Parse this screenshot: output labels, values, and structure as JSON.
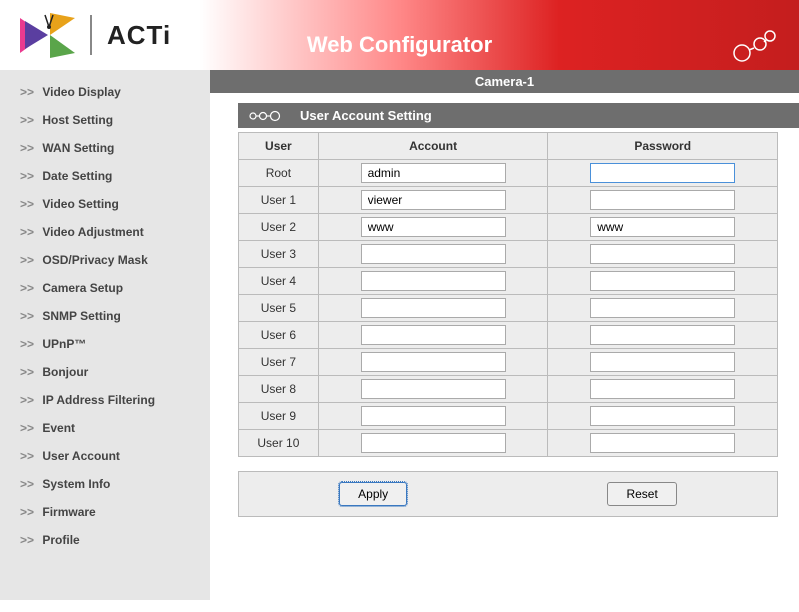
{
  "header": {
    "brand": "ACTi",
    "title": "Web Configurator"
  },
  "camera_bar": "Camera-1",
  "section_title": "User Account Setting",
  "sidebar": {
    "items": [
      "Video Display",
      "Host Setting",
      "WAN Setting",
      "Date Setting",
      "Video Setting",
      "Video Adjustment",
      "OSD/Privacy Mask",
      "Camera Setup",
      "SNMP Setting",
      "UPnP™",
      "Bonjour",
      "IP Address Filtering",
      "Event",
      "User Account",
      "System Info",
      "Firmware",
      "Profile"
    ]
  },
  "table": {
    "headers": {
      "user": "User",
      "account": "Account",
      "password": "Password"
    },
    "rows": [
      {
        "label": "Root",
        "account": "admin",
        "password": "",
        "active": true
      },
      {
        "label": "User 1",
        "account": "viewer",
        "password": ""
      },
      {
        "label": "User 2",
        "account": "www",
        "password": "www"
      },
      {
        "label": "User 3",
        "account": "",
        "password": ""
      },
      {
        "label": "User 4",
        "account": "",
        "password": ""
      },
      {
        "label": "User 5",
        "account": "",
        "password": ""
      },
      {
        "label": "User 6",
        "account": "",
        "password": ""
      },
      {
        "label": "User 7",
        "account": "",
        "password": ""
      },
      {
        "label": "User 8",
        "account": "",
        "password": ""
      },
      {
        "label": "User 9",
        "account": "",
        "password": ""
      },
      {
        "label": "User 10",
        "account": "",
        "password": ""
      }
    ]
  },
  "buttons": {
    "apply": "Apply",
    "reset": "Reset"
  }
}
